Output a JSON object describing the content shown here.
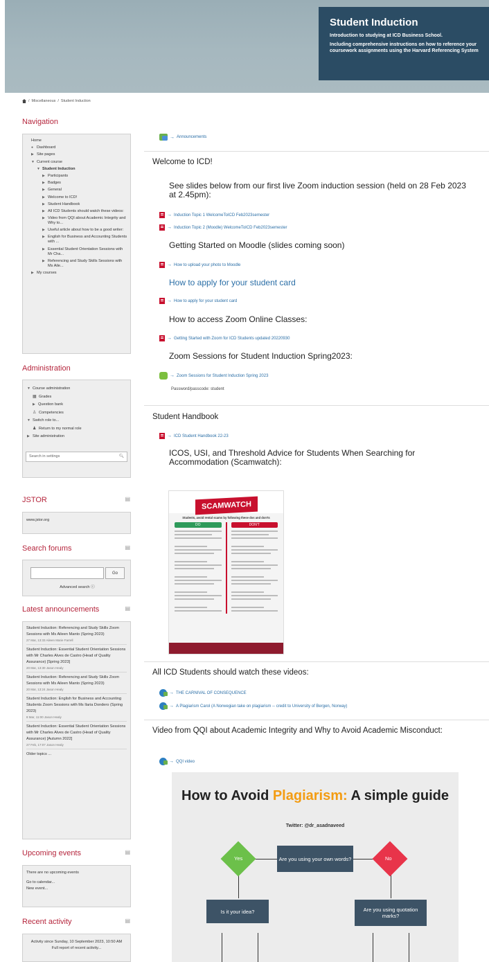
{
  "banner": {
    "title": "Student Induction",
    "line1": "Introduction to studying at ICD Business School.",
    "line2": "Including comprehensive instructions on how to reference your coursework assignments using the Harvard Referencing System"
  },
  "breadcrumb": {
    "items": [
      "Miscellaneous",
      "Student Induction"
    ],
    "sep": "/"
  },
  "navigation": {
    "title": "Navigation",
    "items": [
      {
        "label": "Home",
        "arrow": ""
      },
      {
        "label": "Dashboard",
        "arrow": "●"
      },
      {
        "label": "Site pages",
        "arrow": "▶"
      },
      {
        "label": "Current course",
        "arrow": "▼"
      },
      {
        "label": "Student Induction",
        "arrow": "▼"
      },
      {
        "label": "Participants",
        "arrow": "▶"
      },
      {
        "label": "Badges",
        "arrow": "▶"
      },
      {
        "label": "General",
        "arrow": "▶"
      },
      {
        "label": "Welcome to ICD!",
        "arrow": "▶"
      },
      {
        "label": "Student Handbook",
        "arrow": "▶"
      },
      {
        "label": "All ICD Students should watch these videos:",
        "arrow": "▶"
      },
      {
        "label": "Video from QQI about Academic Integrity and Why to...",
        "arrow": "▶"
      },
      {
        "label": "Useful article about how to be a good writer:",
        "arrow": "▶"
      },
      {
        "label": "English for Business and Accounting Students with ...",
        "arrow": "▶"
      },
      {
        "label": "Essential Student Orientation Sessions with Mr Cha...",
        "arrow": "▶"
      },
      {
        "label": "Referencing and Study Skills Sessions with Ms Aile...",
        "arrow": "▶"
      },
      {
        "label": "My courses",
        "arrow": "▶"
      }
    ]
  },
  "administration": {
    "title": "Administration",
    "items": [
      {
        "label": "Course administration",
        "arrow": "▼",
        "icon": ""
      },
      {
        "label": "Grades",
        "arrow": "",
        "icon": "▦"
      },
      {
        "label": "Question bank",
        "arrow": "▶",
        "icon": ""
      },
      {
        "label": "Competencies",
        "arrow": "",
        "icon": "♙"
      },
      {
        "label": "Switch role to...",
        "arrow": "▼",
        "icon": ""
      },
      {
        "label": "Return to my normal role",
        "arrow": "",
        "icon": "♟"
      },
      {
        "label": "Site administration",
        "arrow": "▶",
        "icon": ""
      }
    ],
    "search_placeholder": "Search in settings"
  },
  "jstor": {
    "title": "JSTOR",
    "link": "www.jstor.org"
  },
  "search_forums": {
    "title": "Search forums",
    "go": "Go",
    "advanced": "Advanced search"
  },
  "latest_announcements": {
    "title": "Latest announcements",
    "items": [
      {
        "text": "Student Induction: Referencing and Study Skills Zoom Sessions with Ms Aileen Manto (Spring 2023)",
        "meta": "27 Mar, 13:33 Aileen Marie Farrell"
      },
      {
        "text": "Student Induction: Essential Student Orientation Sessions with Mr Charles Alves de Castro (Head of Quality Assurance) [Spring 2023]",
        "meta": "20 Mar, 13:30 Jason Healy"
      },
      {
        "text": "Student Induction: Referencing and Study Skills Zoom Sessions with Ms Aileen Manto (Spring 2023)",
        "meta": "20 Mar, 13:24 Jason Healy"
      },
      {
        "text": "Student Induction: English for Business and Accounting Students Zoom Sessions with Ms Ilaria Dondero (Spring 2023)",
        "meta": "8 Mar, 11:00 Jason Healy"
      },
      {
        "text": "Student Induction: Essential Student Orientation Sessions with Mr Charles Alves de Castro (Head of Quality Assurance) [Autumn 2022]",
        "meta": "27 Feb, 17:07 Jason Healy"
      }
    ],
    "older": "Older topics ..."
  },
  "upcoming_events": {
    "title": "Upcoming events",
    "none": "There are no upcoming events",
    "calendar": "Go to calendar...",
    "new_event": "New event..."
  },
  "recent_activity": {
    "title": "Recent activity",
    "since": "Activity since Sunday, 10 September 2023, 10:50 AM",
    "full_report": "Full report of recent activity..."
  },
  "main": {
    "announcements": "Announcements",
    "welcome_title": "Welcome to ICD!",
    "slides_intro": "See slides below from our first live Zoom induction session (held on 28 Feb 2023 at 2.45pm):",
    "topic1": "Induction Topic 1 WelcomeToICD Feb2023semester",
    "topic2": "Induction Topic 2 (Moodle) WelcomeToICD Feb2023semester",
    "getting_started": "Getting Started on Moodle (slides coming soon)",
    "upload_photo": "How to upload your photo to Moodle",
    "student_card_heading": "How to apply for your student card",
    "student_card_link": "How to apply for your student card",
    "zoom_access": "How to access Zoom Online Classes:",
    "zoom_guide": "Getting Started with Zoom for ICD Students updated 20220930",
    "zoom_sessions_heading": "Zoom Sessions for Student Induction Spring2023:",
    "zoom_sessions_link": "Zoom Sessions for Student Induction Spring 2023",
    "passcode": "Password/passcode: student",
    "handbook_title": "Student Handbook",
    "handbook_link": "ICD Student Handbook 22-23",
    "icos_heading": "ICOS, USI, and Threshold Advice for Students When Searching for Accommodation (Scamwatch):",
    "videos_title": "All ICD Students should watch these videos:",
    "video1": "THE CARNIVAL OF CONSEQUENCE",
    "video2": "A Plagiarism Carol (A Norwegian take on plagiarism -- credit to University of Bergen, Norway)",
    "qqi_title": "Video from QQI about Academic Integrity and Why to Avoid Academic Misconduct:",
    "qqi_link": "QQI video"
  },
  "poster": {
    "banner": "SCAMWATCH",
    "subtitle": "Students, avoid rental scams by following these dos and don'ts",
    "do": "DO",
    "dont": "DON'T"
  },
  "guide": {
    "title_a": "How to Avoid ",
    "title_b": "Plagiarism:",
    "title_c": " A simple guide",
    "twitter": "Twitter: @dr_asadnaveed",
    "q1": "Are you using your own words?",
    "yes": "Yes",
    "no": "No",
    "q2": "Is it your idea?",
    "q3": "Are you using quotation marks?"
  },
  "colors": {
    "accent_red": "#b5253c",
    "link_blue": "#2a6ea6",
    "banner_box": "#2b4c64",
    "yes_green": "#6cc04a",
    "no_red": "#e8344a",
    "plagiarism_orange": "#f39c12"
  }
}
